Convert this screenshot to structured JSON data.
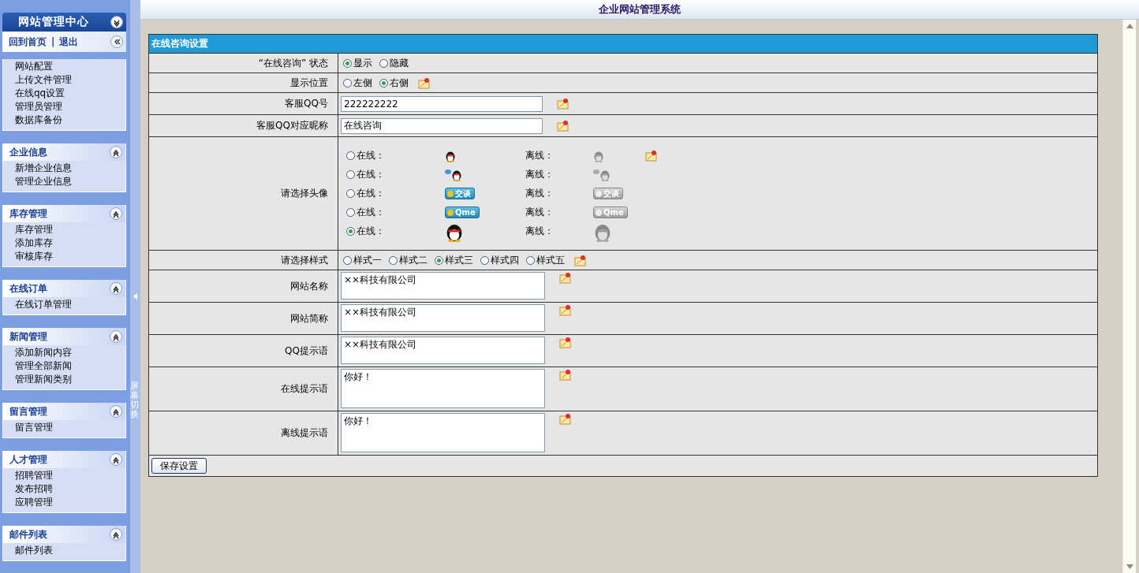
{
  "header": {
    "title": "企业网站管理系统"
  },
  "sidebar": {
    "title": "网站管理中心",
    "links": [
      "回到首页",
      "退出"
    ],
    "separator": "|",
    "sections": [
      {
        "items": [
          "网站配置",
          "上传文件管理",
          "在线qq设置",
          "管理员管理",
          "数据库备份"
        ]
      },
      {
        "title": "企业信息",
        "items": [
          "新增企业信息",
          "管理企业信息"
        ]
      },
      {
        "title": "库存管理",
        "items": [
          "库存管理",
          "添加库存",
          "审核库存"
        ]
      },
      {
        "title": "在线订单",
        "items": [
          "在线订单管理"
        ]
      },
      {
        "title": "新闻管理",
        "items": [
          "添加新闻内容",
          "管理全部新闻",
          "管理新闻类别"
        ]
      },
      {
        "title": "留言管理",
        "items": [
          "留言管理"
        ]
      },
      {
        "title": "人才管理",
        "items": [
          "招聘管理",
          "发布招聘",
          "应聘管理"
        ]
      },
      {
        "title": "邮件列表",
        "items": [
          "邮件列表"
        ]
      }
    ]
  },
  "splitter": {
    "label": "屏幕切换"
  },
  "form": {
    "title": "在线咨询设置",
    "rows": [
      {
        "kind": "radio",
        "label": "“在线咨询” 状态",
        "edit": false,
        "options": [
          {
            "label": "显示",
            "selected": true
          },
          {
            "label": "隐藏",
            "selected": false
          }
        ]
      },
      {
        "kind": "radio",
        "label": "显示位置",
        "edit": true,
        "options": [
          {
            "label": "左侧",
            "selected": false
          },
          {
            "label": "右侧",
            "selected": true
          }
        ]
      },
      {
        "kind": "text",
        "label": "客服QQ号",
        "value": "222222222"
      },
      {
        "kind": "text",
        "label": "客服QQ对应昵称",
        "value": "在线咨询"
      },
      {
        "kind": "avatar",
        "label": "请选择头像",
        "options": [
          {
            "selected": false,
            "online": "在线：",
            "offline": "离线："
          },
          {
            "selected": false,
            "online": "在线：",
            "offline": "离线："
          },
          {
            "selected": false,
            "online": "在线：",
            "offline": "离线：",
            "online_badge": "交谈",
            "offline_badge": "交谈"
          },
          {
            "selected": false,
            "online": "在线：",
            "offline": "离线：",
            "online_badge": "Qme",
            "offline_badge": "Qme"
          },
          {
            "selected": true,
            "online": "在线：",
            "offline": "离线："
          }
        ]
      },
      {
        "kind": "radio",
        "label": "请选择样式",
        "edit": true,
        "options": [
          {
            "label": "样式一",
            "selected": false
          },
          {
            "label": "样式二",
            "selected": false
          },
          {
            "label": "样式三",
            "selected": true
          },
          {
            "label": "样式四",
            "selected": false
          },
          {
            "label": "样式五",
            "selected": false
          }
        ]
      },
      {
        "kind": "textbox",
        "label": "网站名称",
        "value": "××科技有限公司"
      },
      {
        "kind": "textbox",
        "label": "网站简称",
        "value": "××科技有限公司"
      },
      {
        "kind": "textbox",
        "label": "QQ提示语",
        "value": "××科技有限公司"
      },
      {
        "kind": "textarea",
        "label": "在线提示语",
        "value": "你好！"
      },
      {
        "kind": "textarea",
        "label": "离线提示语",
        "value": "你好！"
      }
    ],
    "save": "保存设置"
  }
}
